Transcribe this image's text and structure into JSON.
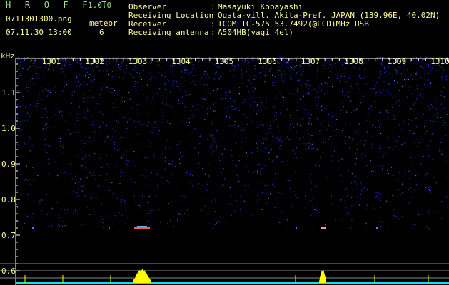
{
  "header": {
    "app_title": "H R O F F T",
    "version": "1.0.0",
    "filename": "0711301300.png",
    "datetime": "07.11.30 13:00",
    "meteor_label": "meteor",
    "meteor_count": "6"
  },
  "info": [
    {
      "key": "Observer",
      "value": "Masayuki Kobayashi"
    },
    {
      "key": "Receiving Location",
      "value": "Ogata-vill. Akita-Pref. JAPAN (139.96E, 40.02N)"
    },
    {
      "key": "Receiver",
      "value": "ICOM IC-575 53.7492(@LCD)MHz USB"
    },
    {
      "key": "Receiving antenna",
      "value": "A504HB(yagi 4el)"
    }
  ],
  "colon": ":",
  "spectrogram": {
    "unit_label": "kHz",
    "time_ticks": [
      "1301",
      "1302",
      "1303",
      "1304",
      "1305",
      "1306",
      "1307",
      "1308",
      "1309",
      "1310"
    ],
    "freq_ticks": [
      "1.1",
      "1.0",
      "0.9",
      "0.8",
      "0.7",
      "0.6"
    ],
    "colors": {
      "axis": "#ffffff",
      "noise": "#3a3aff",
      "text": "#fffb9a",
      "title": "#9be08a",
      "trace": "#ffff00",
      "baseline": "#00e5e5"
    }
  }
}
